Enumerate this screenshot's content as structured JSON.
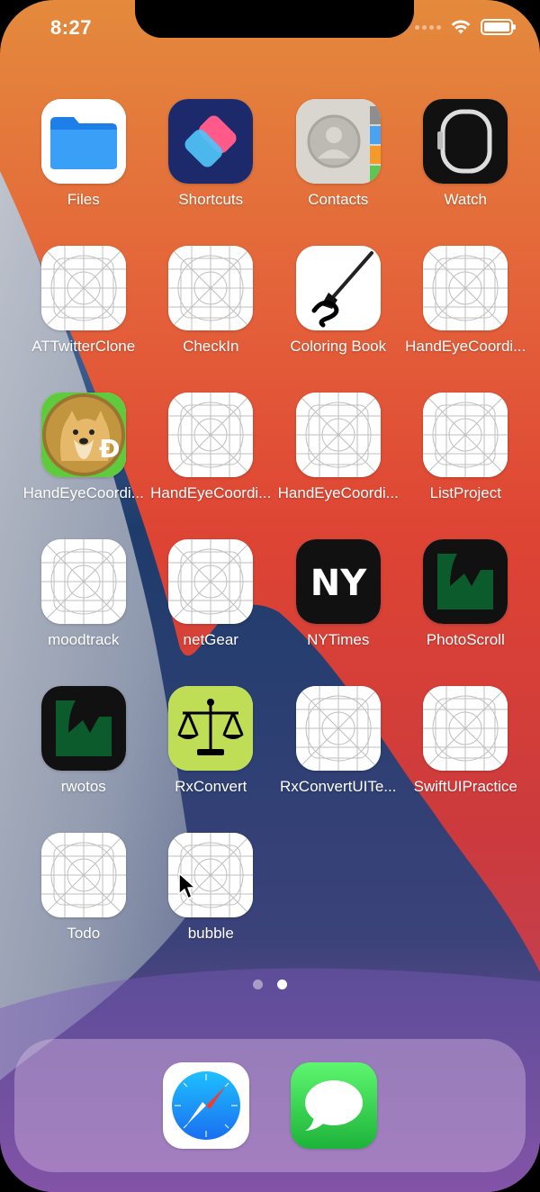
{
  "status_bar": {
    "time": "8:27"
  },
  "apps": [
    {
      "label": "Files",
      "icon": "files-icon",
      "type": "files"
    },
    {
      "label": "Shortcuts",
      "icon": "shortcuts-icon",
      "type": "shortcuts"
    },
    {
      "label": "Contacts",
      "icon": "contacts-icon",
      "type": "contacts"
    },
    {
      "label": "Watch",
      "icon": "watch-icon",
      "type": "watch"
    },
    {
      "label": "ATTwitterClone",
      "icon": "placeholder-app-icon",
      "type": "placeholder"
    },
    {
      "label": "CheckIn",
      "icon": "placeholder-app-icon",
      "type": "placeholder"
    },
    {
      "label": "Coloring Book",
      "icon": "paintbrush-icon",
      "type": "coloring"
    },
    {
      "label": "HandEyeCoordi...",
      "icon": "placeholder-app-icon",
      "type": "placeholder"
    },
    {
      "label": "HandEyeCoordi...",
      "icon": "doge-coin-icon",
      "type": "doge"
    },
    {
      "label": "HandEyeCoordi...",
      "icon": "placeholder-app-icon",
      "type": "placeholder"
    },
    {
      "label": "HandEyeCoordi...",
      "icon": "placeholder-app-icon",
      "type": "placeholder"
    },
    {
      "label": "ListProject",
      "icon": "placeholder-app-icon",
      "type": "placeholder"
    },
    {
      "label": "moodtrack",
      "icon": "placeholder-app-icon",
      "type": "placeholder"
    },
    {
      "label": "netGear",
      "icon": "placeholder-app-icon",
      "type": "placeholder"
    },
    {
      "label": "NYTimes",
      "icon": "nytimes-icon",
      "type": "nyt",
      "text": "NY"
    },
    {
      "label": "PhotoScroll",
      "icon": "photoscroll-icon",
      "type": "rw"
    },
    {
      "label": "rwotos",
      "icon": "rwotos-icon",
      "type": "rw"
    },
    {
      "label": "RxConvert",
      "icon": "scales-icon",
      "type": "scales"
    },
    {
      "label": "RxConvertUITe...",
      "icon": "placeholder-app-icon",
      "type": "placeholder"
    },
    {
      "label": "SwiftUIPractice",
      "icon": "placeholder-app-icon",
      "type": "placeholder"
    },
    {
      "label": "Todo",
      "icon": "placeholder-app-icon",
      "type": "placeholder"
    },
    {
      "label": "bubble",
      "icon": "placeholder-app-icon",
      "type": "placeholder"
    }
  ],
  "page_indicator": {
    "pages": 2,
    "current": 2
  },
  "dock": [
    {
      "name": "safari",
      "icon": "safari-compass-icon"
    },
    {
      "name": "messages",
      "icon": "messages-bubble-icon"
    }
  ],
  "colors": {
    "files_blue": "#1e88f0",
    "shortcuts_bg": "#1c2a6b",
    "nyt_bg": "#111111",
    "rw_green": "#0c5b2c",
    "rx_green": "#bfdd55",
    "messages_green": "#31c64a",
    "safari_blue": "#1d8ff2"
  }
}
